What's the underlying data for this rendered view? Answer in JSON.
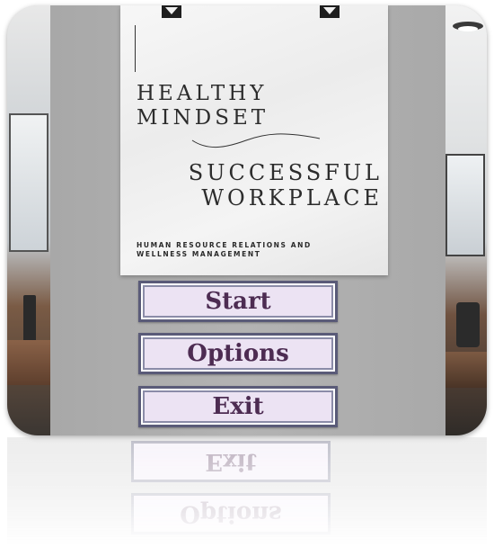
{
  "poster": {
    "title_line1": "HEALTHY",
    "title_line2": "MINDSET",
    "title2_line1": "SUCCESSFUL",
    "title2_line2": "WORKPLACE",
    "subtitle_line1": "HUMAN RESOURCE RELATIONS AND",
    "subtitle_line2": "WELLNESS MANAGEMENT"
  },
  "menu": {
    "start_label": "Start",
    "options_label": "Options",
    "exit_label": "Exit"
  },
  "colors": {
    "button_fill": "#ece3f3",
    "button_border": "#5a5b78",
    "button_text": "#4d2c52",
    "wall": "#b0b0b0"
  }
}
